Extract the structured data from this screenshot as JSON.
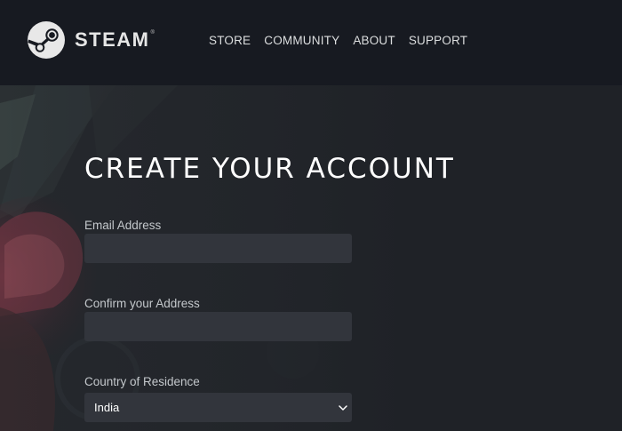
{
  "header": {
    "brand": "STEAM",
    "brand_mark": "®",
    "logo_icon": "steam-logo-icon",
    "nav": [
      {
        "label": "STORE"
      },
      {
        "label": "COMMUNITY"
      },
      {
        "label": "ABOUT"
      },
      {
        "label": "SUPPORT"
      }
    ]
  },
  "form": {
    "title": "CREATE YOUR ACCOUNT",
    "email": {
      "label": "Email Address",
      "value": ""
    },
    "confirm": {
      "label": "Confirm your Address",
      "value": ""
    },
    "country": {
      "label": "Country of Residence",
      "value": "India",
      "icon": "chevron-down-icon"
    }
  },
  "colors": {
    "header_bg": "#171a21",
    "main_bg": "#1f2227",
    "input_bg": "#32353c",
    "text": "#ffffff",
    "label": "#c4c8cc"
  }
}
